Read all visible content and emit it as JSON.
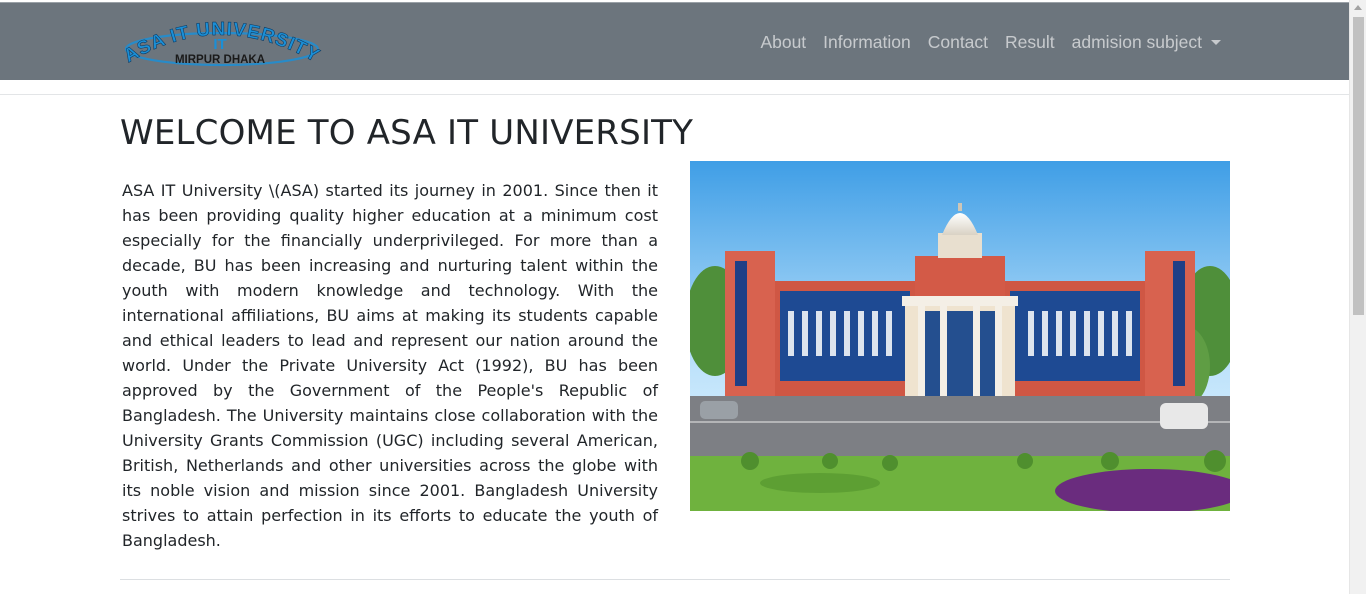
{
  "navbar": {
    "logo": {
      "arc_text": "ASA IT UNIVERSITY",
      "center_text": "IT",
      "bottom_text": "MIRPUR DHAKA"
    },
    "links": [
      {
        "label": "About"
      },
      {
        "label": "Information"
      },
      {
        "label": "Contact"
      },
      {
        "label": "Result"
      }
    ],
    "dropdown": {
      "label": "admision subject"
    }
  },
  "main": {
    "title": "WELCOME TO ASA IT UNIVERSITY",
    "body": "ASA IT University \\(ASA) started its journey in 2001. Since then it has been providing quality higher education at a minimum cost especially for the financially underprivileged. For more than a decade, BU has been increasing and nurturing talent within the youth with modern knowledge and technology. With the international affiliations, BU aims at making its students capable and ethical leaders to lead and represent our nation around the world. Under the Private University Act (1992), BU has been approved by the Government of the People's Republic of Bangladesh. The University maintains close collaboration with the University Grants Commission (UGC) including several American, British, Netherlands and other universities across the globe with its noble vision and mission since 2001. Bangladesh University strives to attain perfection in its efforts to educate the youth of Bangladesh."
  },
  "colors": {
    "navbar_bg": "#6c757d",
    "nav_link": "rgba(255,255,255,0.62)",
    "logo_blue": "#1b8fd6",
    "text": "#212529"
  },
  "icons": {
    "dropdown": "caret-down-icon"
  }
}
